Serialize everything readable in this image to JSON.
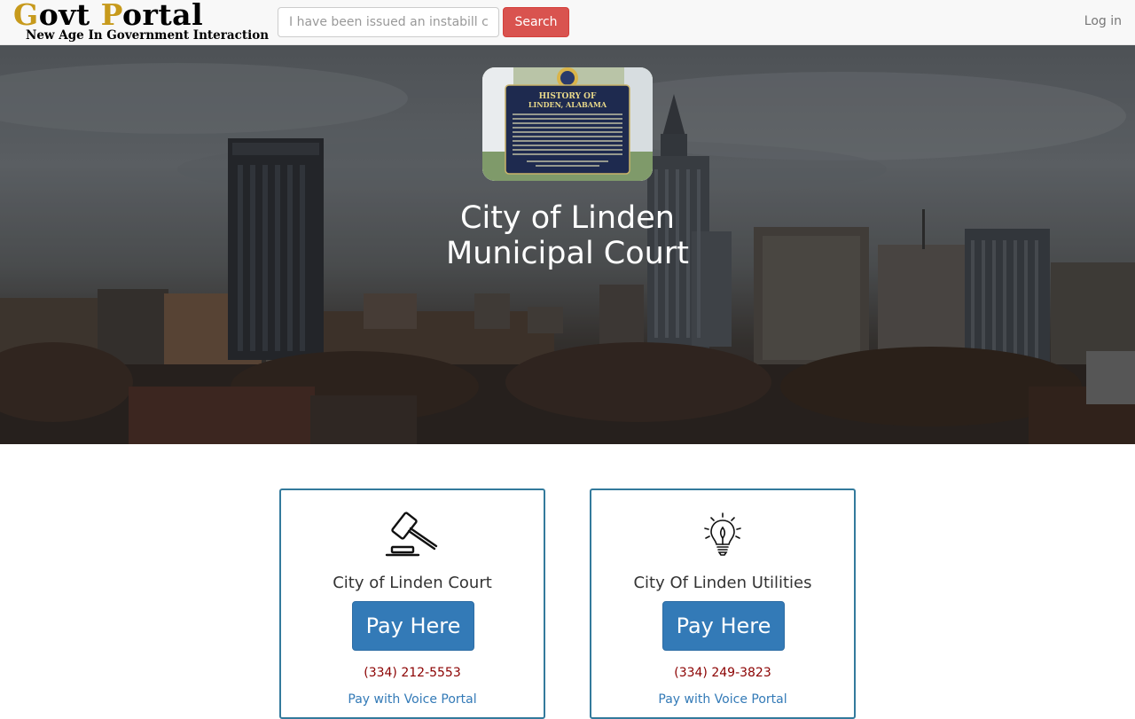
{
  "navbar": {
    "brand_first": "G",
    "brand_rest1": "ovt ",
    "brand_second": "P",
    "brand_rest2": "ortal",
    "tagline": "New Age In Government Interaction",
    "search_placeholder": "I have been issued an instabill citation",
    "search_label": "Search",
    "login_label": "Log in"
  },
  "hero": {
    "title_line1": "City of Linden",
    "title_line2": "Municipal Court",
    "seal": {
      "heading": "HISTORY OF",
      "subheading": "LINDEN, ALABAMA"
    }
  },
  "cards": [
    {
      "title": "City of Linden Court",
      "button": "Pay Here",
      "phone": "(334) 212-5553",
      "voice": "Pay with Voice Portal",
      "icon": "gavel-icon"
    },
    {
      "title": "City Of Linden Utilities",
      "button": "Pay Here",
      "phone": "(334) 249-3823",
      "voice": "Pay with Voice Portal",
      "icon": "lightbulb-icon"
    }
  ],
  "colors": {
    "brand_accent": "#c79a1c",
    "search_button": "#d9534f",
    "pay_button": "#337ab7",
    "card_border": "#337a9c",
    "phone_text": "#8b0000"
  }
}
